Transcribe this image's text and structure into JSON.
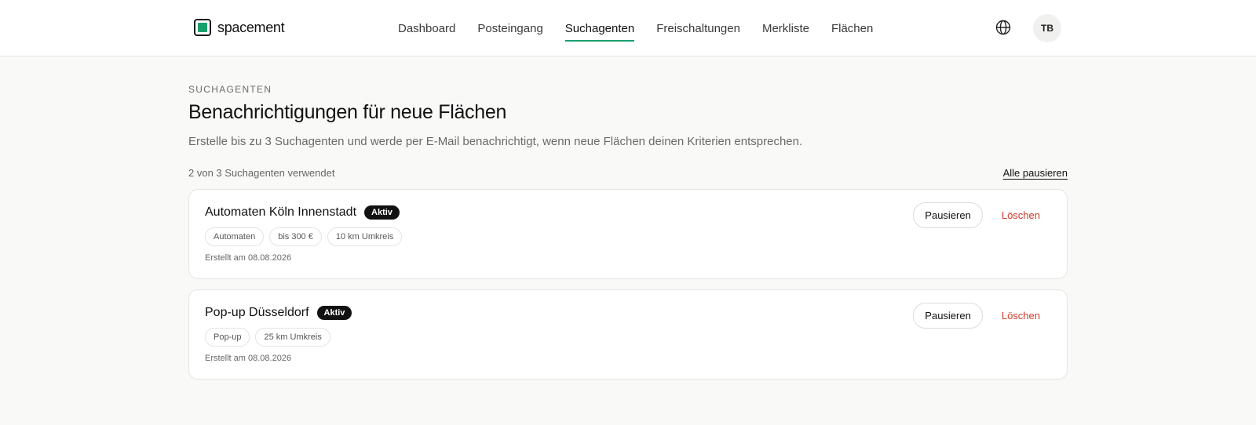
{
  "brand": {
    "name": "spacement"
  },
  "nav": [
    {
      "label": "Dashboard",
      "active": false
    },
    {
      "label": "Posteingang",
      "active": false
    },
    {
      "label": "Suchagenten",
      "active": true
    },
    {
      "label": "Freischaltungen",
      "active": false
    },
    {
      "label": "Merkliste",
      "active": false
    },
    {
      "label": "Flächen",
      "active": false
    }
  ],
  "user": {
    "initials": "TB"
  },
  "page": {
    "eyebrow": "SUCHAGENTEN",
    "title": "Benachrichtigungen für neue Flächen",
    "subtitle": "Erstelle bis zu 3 Suchagenten und werde per E-Mail benachrichtigt, wenn neue Flächen deinen Kriterien entsprechen.",
    "usage": "2 von 3 Suchagenten verwendet",
    "pause_all": "Alle pausieren"
  },
  "agents": [
    {
      "title": "Automaten Köln Innenstadt",
      "status": "Aktiv",
      "tags": [
        "Automaten",
        "bis 300 €",
        "10 km Umkreis"
      ],
      "created": "Erstellt am 08.08.2026",
      "pause_label": "Pausieren",
      "delete_label": "Löschen"
    },
    {
      "title": "Pop-up Düsseldorf",
      "status": "Aktiv",
      "tags": [
        "Pop-up",
        "25 km Umkreis"
      ],
      "created": "Erstellt am 08.08.2026",
      "pause_label": "Pausieren",
      "delete_label": "Löschen"
    }
  ],
  "colors": {
    "accent": "#17a06b",
    "danger": "#d13a2b",
    "badge_bg": "#111111"
  },
  "icons": {
    "language": "globe-icon",
    "logo": "logo-icon"
  }
}
